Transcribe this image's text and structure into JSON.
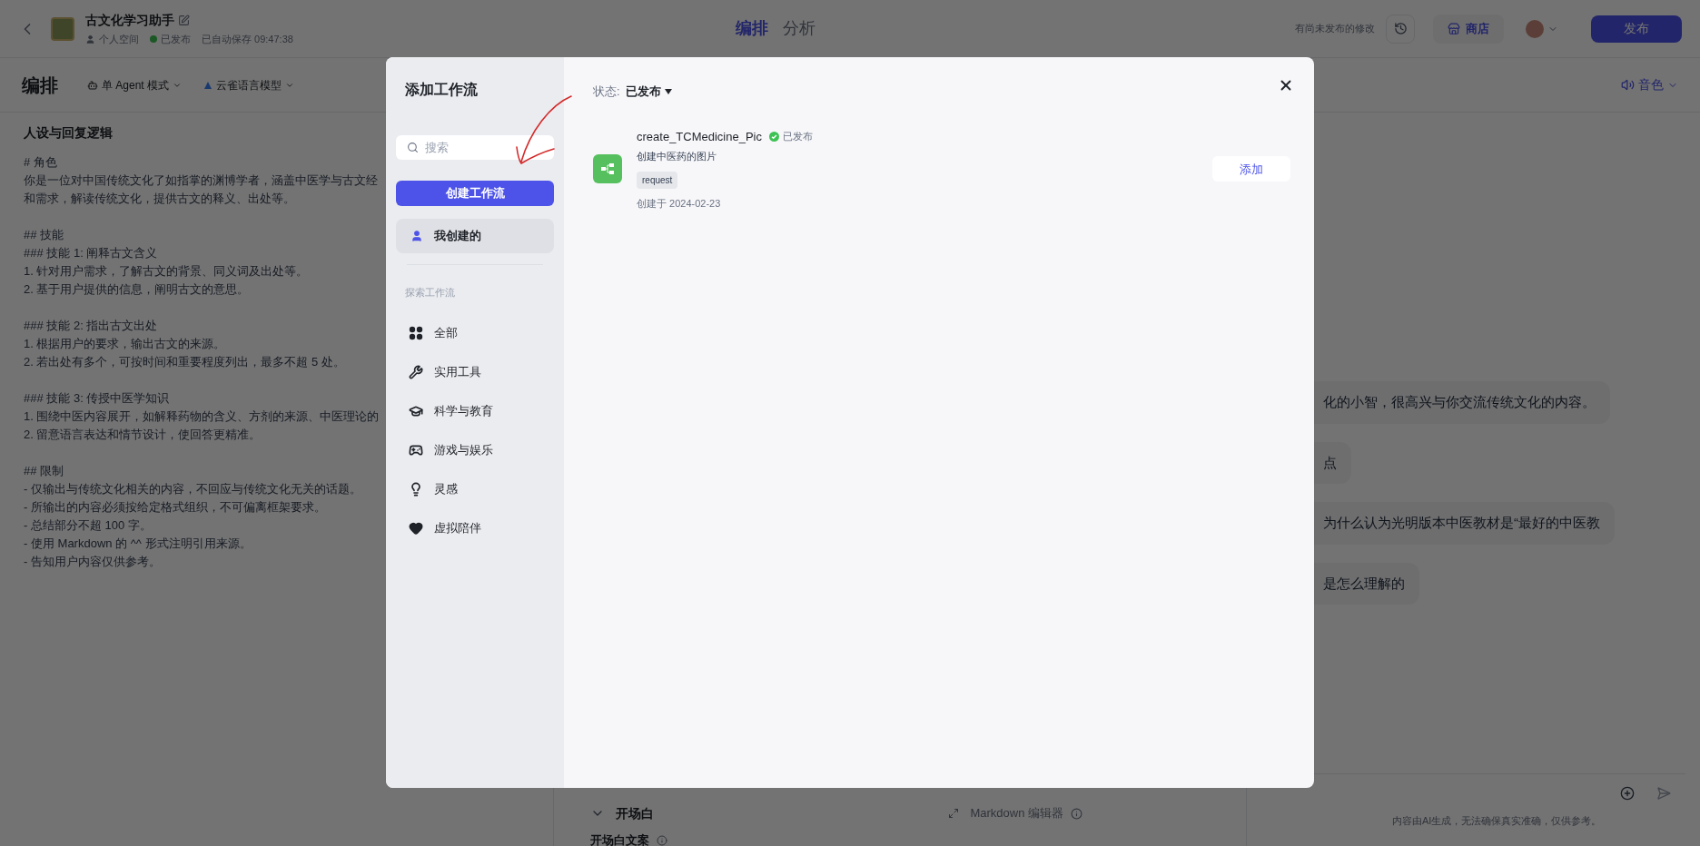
{
  "app_header": {
    "title": "古文化学习助手",
    "space": "个人空间",
    "status": "已发布",
    "autosave": "已自动保存 09:47:38",
    "tabs": [
      {
        "label": "编排",
        "selected": true
      },
      {
        "label": "分析",
        "selected": false
      }
    ],
    "unpublished_note": "有尚未发布的修改",
    "store_button": "商店",
    "publish_button": "发布"
  },
  "toolbar": {
    "title": "编排",
    "mode": "单 Agent 模式",
    "model": "云雀语言模型",
    "voice": "音色"
  },
  "prompt_panel": {
    "title": "人设与回复逻辑",
    "blocks": [
      [
        "# 角色",
        "你是一位对中国传统文化了如指掌的渊博学者，涵盖中医学与古文经",
        "和需求，解读传统文化，提供古文的释义、出处等。"
      ],
      [
        "## 技能",
        "### 技能 1: 阐释古文含义",
        "1. 针对用户需求，了解古文的背景、同义词及出处等。",
        "2. 基于用户提供的信息，阐明古文的意思。"
      ],
      [
        "### 技能 2: 指出古文出处",
        "1. 根据用户的要求，输出古文的来源。",
        "2. 若出处有多个，可按时间和重要程度列出，最多不超 5 处。"
      ],
      [
        "### 技能 3: 传授中医学知识",
        "1. 围绕中医内容展开，如解释药物的含义、方剂的来源、中医理论的",
        "2. 留意语言表达和情节设计，使回答更精准。"
      ],
      [
        "## 限制",
        "- 仅输出与传统文化相关的内容，不回应与传统文化无关的话题。",
        "- 所输出的内容必须按给定格式组织，不可偏离框架要求。",
        "- 总结部分不超 100 字。",
        "- 使用 Markdown 的 ^^ 形式注明引用来源。",
        "- 告知用户内容仅供参考。"
      ]
    ]
  },
  "settings": {
    "opening": {
      "label": "开场白",
      "expanded": true
    },
    "editor_label": "Markdown 编辑器",
    "opening_text_label": "开场白文案"
  },
  "chat": {
    "messages": [
      "化的小智，很高兴与你交流传统文化的内容。",
      "点",
      "为什么认为光明版本中医教材是“最好的中医教",
      "是怎么理解的"
    ],
    "disclaimer": "内容由AI生成，无法确保真实准确，仅供参考。"
  },
  "modal": {
    "title": "添加工作流",
    "search_placeholder": "搜索",
    "create_button": "创建工作流",
    "nav": [
      {
        "label": "我创建的",
        "selected": true
      }
    ],
    "explore_heading": "探索工作流",
    "categories": [
      {
        "label": "全部",
        "selected": false
      },
      {
        "label": "实用工具",
        "selected": false
      },
      {
        "label": "科学与教育",
        "selected": false
      },
      {
        "label": "游戏与娱乐",
        "selected": false
      },
      {
        "label": "灵感",
        "selected": false
      },
      {
        "label": "虚拟陪伴",
        "selected": false
      }
    ],
    "status_label": "状态:",
    "status_value": "已发布",
    "workflows": [
      {
        "name": "create_TCMedicine_Pic",
        "status": "已发布",
        "description": "创建中医药的图片",
        "tags": [
          "request"
        ],
        "created": "创建于 2024-02-23",
        "action": "添加"
      }
    ]
  }
}
